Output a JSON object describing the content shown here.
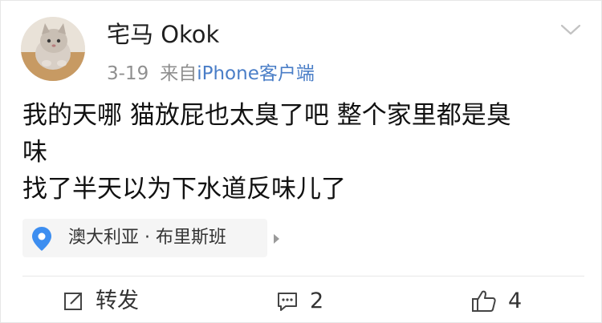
{
  "post": {
    "username": "宅马 Okok",
    "date": "3-19",
    "source_prefix": "来自",
    "source_name": "iPhone客户端",
    "content_lines": [
      "我的天哪 猫放屁也太臭了吧 整个家里都是臭",
      "味",
      "找了半天以为下水道反味儿了"
    ],
    "location": "澳大利亚 · 布里斯班"
  },
  "actions": {
    "repost_label": "转发",
    "comment_count": "2",
    "like_count": "4"
  },
  "icons": {
    "avatar": "cat-avatar",
    "menu": "chevron-down-icon",
    "location": "location-pin-icon",
    "repost": "repost-icon",
    "comment": "comment-icon",
    "like": "thumbs-up-icon"
  },
  "colors": {
    "link": "#4a7ec7",
    "location_pin": "#3d8ef0",
    "meta_text": "#8f8f8f"
  }
}
